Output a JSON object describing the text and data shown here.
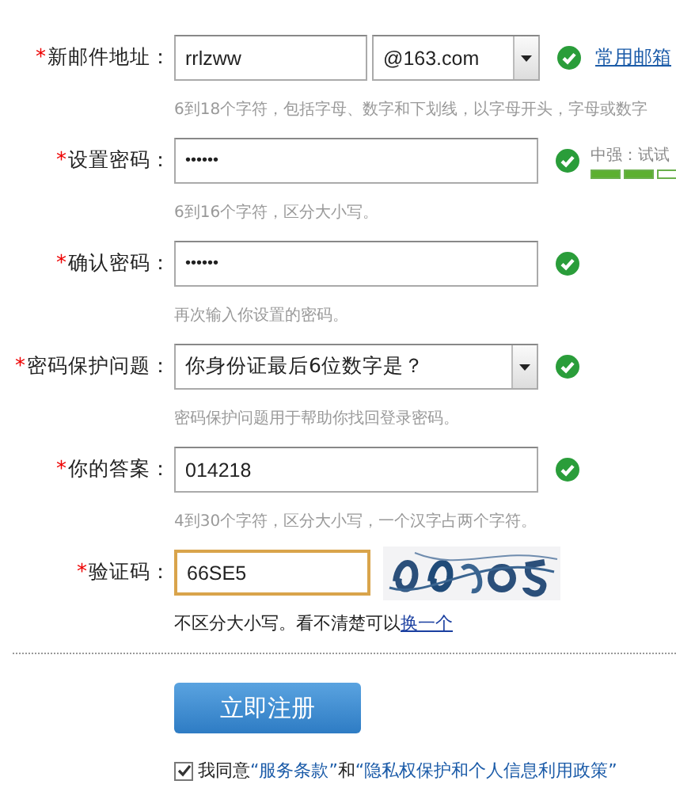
{
  "form": {
    "rows": [
      {
        "kind": "email",
        "label": "新邮件地址：",
        "required": "*",
        "value": "rrlzww",
        "domain": "@163.com",
        "valid": true,
        "link": "常用邮箱",
        "hint": "6到18个字符，包括字母、数字和下划线，以字母开头，字母或数字"
      },
      {
        "kind": "password",
        "label": "设置密码：",
        "required": "*",
        "value": "••••••",
        "valid": true,
        "strength": {
          "label": "中强：试试",
          "level": 0.67
        },
        "hint": "6到16个字符，区分大小写。"
      },
      {
        "kind": "password",
        "label": "确认密码：",
        "required": "*",
        "value": "••••••",
        "valid": true,
        "hint": "再次输入你设置的密码。"
      },
      {
        "kind": "select",
        "label": "密码保护问题：",
        "required": "*",
        "value": "你身份证最后6位数字是？",
        "valid": true,
        "hint": "密码保护问题用于帮助你找回登录密码。"
      },
      {
        "kind": "text",
        "label": "你的答案：",
        "required": "*",
        "value": "014218",
        "valid": true,
        "hint": "4到30个字符，区分大小写，一个汉字占两个字符。"
      },
      {
        "kind": "captcha",
        "label": "验证码：",
        "required": "*",
        "value": "66SE5",
        "focused": true,
        "hint": "不区分大小写。看不清楚可以",
        "hint_link": "换一个"
      }
    ]
  },
  "submit": "立即注册",
  "agreement": {
    "checked": true,
    "text": "我同意",
    "terms": "“服务条款”",
    "and": "和",
    "policy": "“隐私权保护和个人信息利用政策”"
  }
}
